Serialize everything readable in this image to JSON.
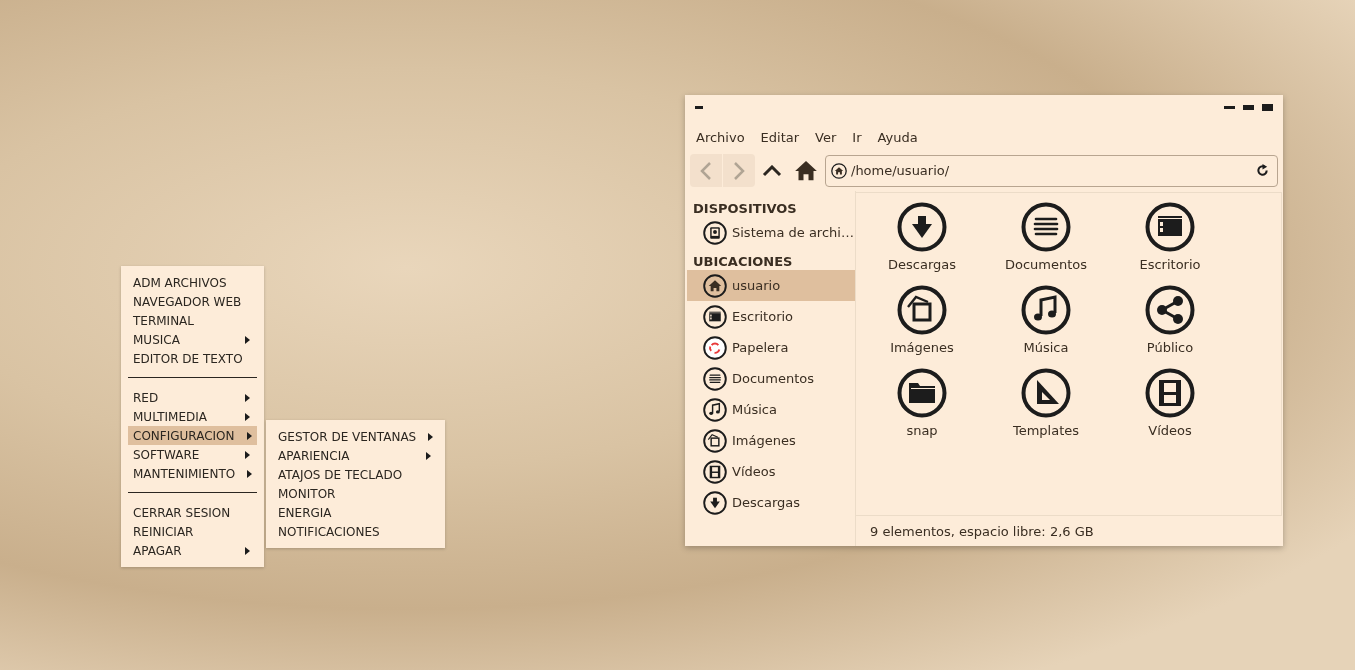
{
  "start_menu": {
    "groups": [
      [
        {
          "label": "ADM ARCHIVOS",
          "submenu": false,
          "selected": false
        },
        {
          "label": "NAVEGADOR WEB",
          "submenu": false,
          "selected": false
        },
        {
          "label": "TERMINAL",
          "submenu": false,
          "selected": false
        },
        {
          "label": "MUSICA",
          "submenu": true,
          "selected": false
        },
        {
          "label": "EDITOR DE TEXTO",
          "submenu": false,
          "selected": false
        }
      ],
      [
        {
          "label": "RED",
          "submenu": true,
          "selected": false
        },
        {
          "label": "MULTIMEDIA",
          "submenu": true,
          "selected": false
        },
        {
          "label": "CONFIGURACION",
          "submenu": true,
          "selected": true
        },
        {
          "label": "SOFTWARE",
          "submenu": true,
          "selected": false
        },
        {
          "label": "MANTENIMIENTO",
          "submenu": true,
          "selected": false
        }
      ],
      [
        {
          "label": "CERRAR SESION",
          "submenu": false,
          "selected": false
        },
        {
          "label": "REINICIAR",
          "submenu": false,
          "selected": false
        },
        {
          "label": "APAGAR",
          "submenu": true,
          "selected": false
        }
      ]
    ]
  },
  "submenu": {
    "items": [
      {
        "label": "GESTOR DE VENTANAS",
        "submenu": true,
        "selected": false
      },
      {
        "label": "APARIENCIA",
        "submenu": true,
        "selected": false
      },
      {
        "label": "ATAJOS DE TECLADO",
        "submenu": false,
        "selected": false
      },
      {
        "label": "MONITOR",
        "submenu": false,
        "selected": false
      },
      {
        "label": "ENERGIA",
        "submenu": false,
        "selected": false
      },
      {
        "label": "NOTIFICACIONES",
        "submenu": false,
        "selected": false
      }
    ]
  },
  "file_manager": {
    "menu_bar": [
      "Archivo",
      "Editar",
      "Ver",
      "Ir",
      "Ayuda"
    ],
    "toolbar": {
      "back_disabled": true,
      "forward_disabled": true,
      "location": "/home/usuario/"
    },
    "sidebar": {
      "sections": [
        {
          "title": "DISPOSITIVOS",
          "items": [
            {
              "label": "Sistema de archi…",
              "kind": "drive",
              "selected": false
            }
          ]
        },
        {
          "title": "UBICACIONES",
          "items": [
            {
              "label": "usuario",
              "kind": "home",
              "selected": true
            },
            {
              "label": "Escritorio",
              "kind": "desktop",
              "selected": false
            },
            {
              "label": "Papelera",
              "kind": "trash",
              "selected": false
            },
            {
              "label": "Documentos",
              "kind": "list",
              "selected": false
            },
            {
              "label": "Música",
              "kind": "music",
              "selected": false
            },
            {
              "label": "Imágenes",
              "kind": "images",
              "selected": false
            },
            {
              "label": "Vídeos",
              "kind": "film",
              "selected": false
            },
            {
              "label": "Descargas",
              "kind": "download",
              "selected": false
            }
          ]
        }
      ]
    },
    "files": [
      {
        "label": "Descargas",
        "kind": "download"
      },
      {
        "label": "Documentos",
        "kind": "list"
      },
      {
        "label": "Escritorio",
        "kind": "desktop"
      },
      {
        "label": "Imágenes",
        "kind": "images"
      },
      {
        "label": "Música",
        "kind": "music"
      },
      {
        "label": "Público",
        "kind": "share"
      },
      {
        "label": "snap",
        "kind": "folder"
      },
      {
        "label": "Templates",
        "kind": "ruler"
      },
      {
        "label": "Vídeos",
        "kind": "film"
      }
    ],
    "status_bar": "9 elementos, espacio libre: 2,6 GB"
  }
}
